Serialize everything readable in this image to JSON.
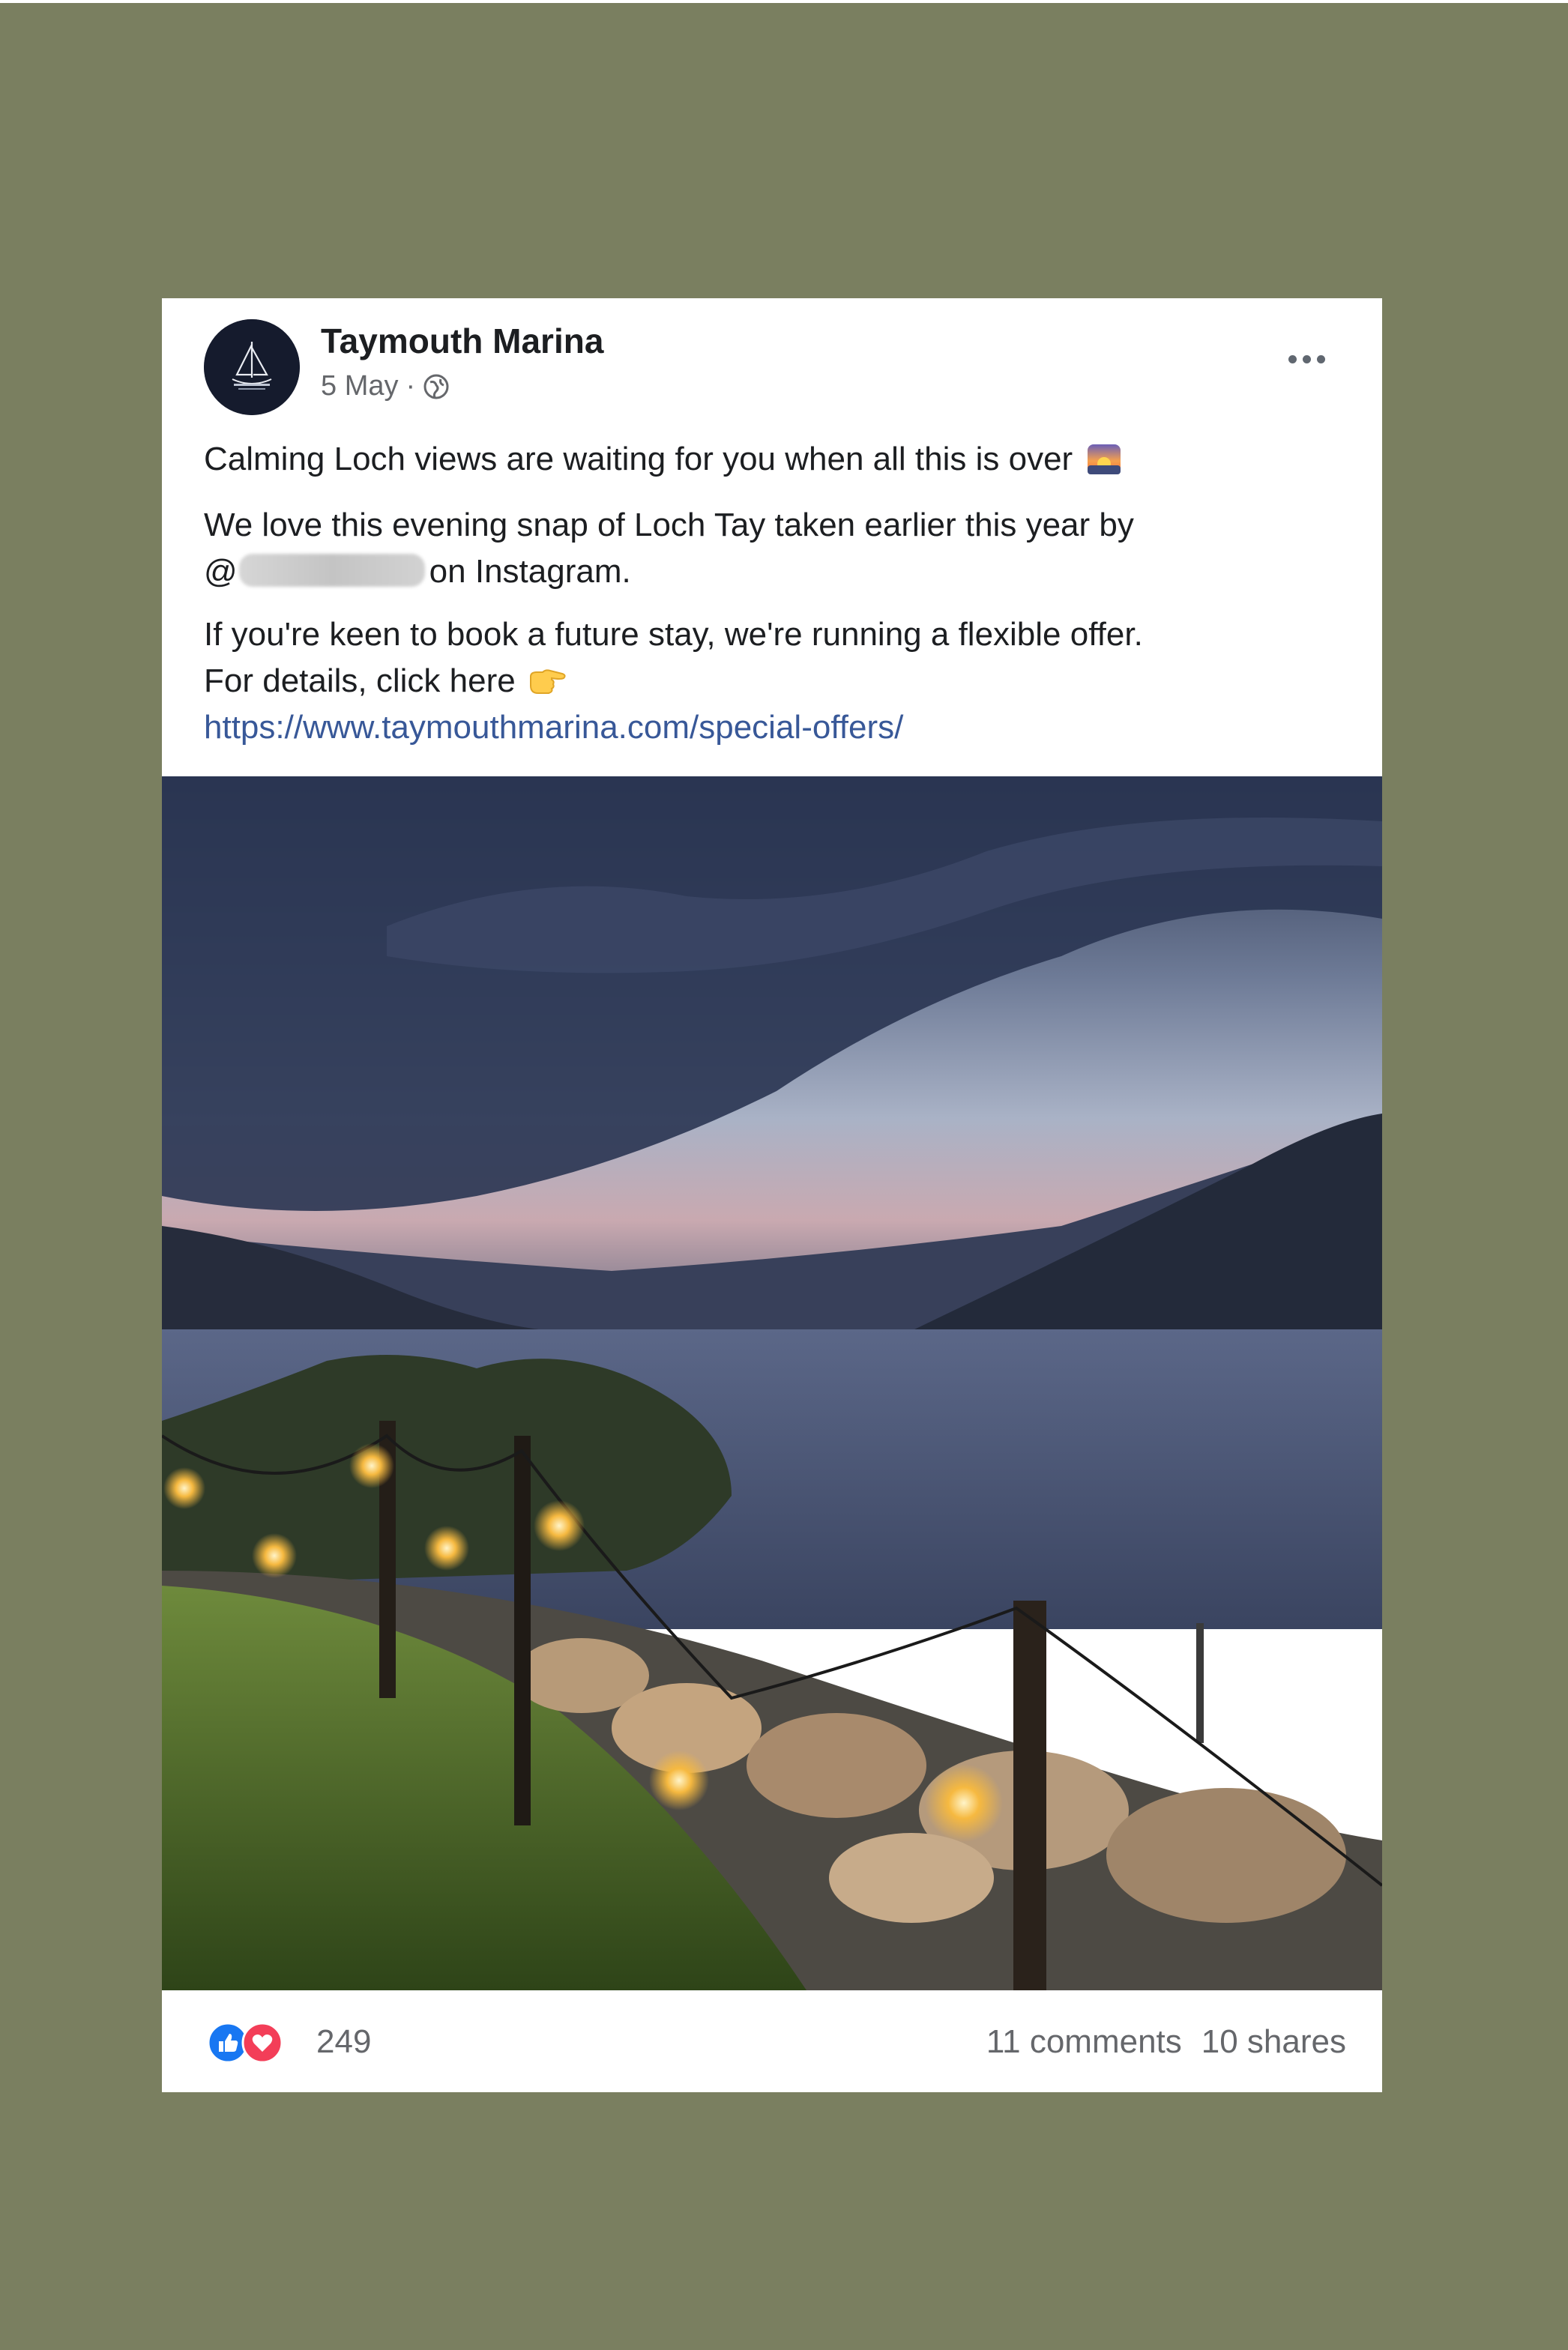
{
  "post": {
    "page_name": "Taymouth Marina",
    "date": "5 May",
    "separator": "·",
    "privacy_icon": "globe-icon",
    "avatar_icon": "sailboat-logo",
    "line1": "Calming Loch views are waiting for you when all this is over",
    "line1_emoji": "sunset-emoji",
    "line2": "We love this evening snap of Loch Tay taken earlier this year by",
    "line3_prefix": "@",
    "line3_suffix": "on Instagram.",
    "line4": "If you're keen to book a future stay, we're running a flexible offer.",
    "line5": "For details, click here",
    "line5_emoji": "pointing-right-emoji",
    "link": "https://www.taymouthmarina.com/special-offers/"
  },
  "footer": {
    "reaction_icons": [
      "like-icon",
      "love-icon"
    ],
    "reaction_count": "249",
    "comments": "11 comments",
    "shares": "10 shares"
  },
  "colors": {
    "background": "#7a7f60",
    "link": "#385898",
    "like_blue": "#1877f2",
    "love_red": "#f33e58"
  }
}
